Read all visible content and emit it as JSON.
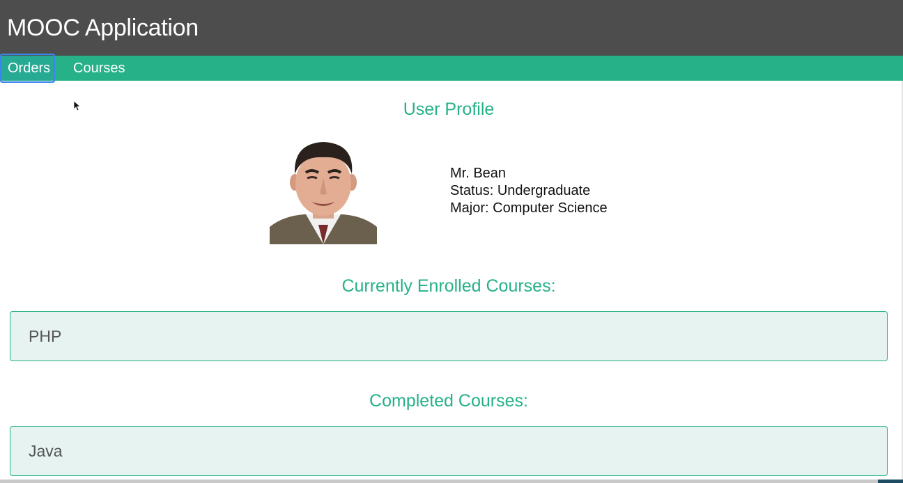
{
  "app": {
    "title": "MOOC Application"
  },
  "nav": {
    "items": [
      {
        "label": "Orders",
        "active": true
      },
      {
        "label": "Courses",
        "active": false
      }
    ]
  },
  "profile": {
    "heading": "User Profile",
    "photo_alt": "Mr. Bean",
    "name": "Mr. Bean",
    "status": "Status: Undergraduate",
    "major": "Major: Computer Science"
  },
  "enrolled": {
    "heading": "Currently Enrolled Courses:",
    "courses": [
      "PHP"
    ]
  },
  "completed": {
    "heading": "Completed Courses:",
    "courses": [
      "Java"
    ]
  },
  "colors": {
    "header_bg": "#4d4d4d",
    "accent": "#26b189",
    "course_box_bg": "#e6f3f0",
    "focus_outline": "#3b86e8"
  },
  "icons": {
    "cursor": "mouse-pointer-icon"
  }
}
